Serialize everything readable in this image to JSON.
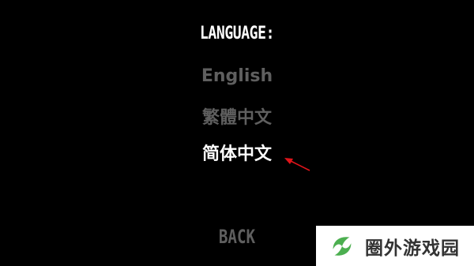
{
  "screen": {
    "title": "LANGUAGE:",
    "languages": [
      {
        "label": "English",
        "selected": false
      },
      {
        "label": "繁體中文",
        "selected": false
      },
      {
        "label": "简体中文",
        "selected": true
      }
    ],
    "back_label": "BACK"
  },
  "annotation": {
    "icon": "red-arrow-icon",
    "color": "#e0141a"
  },
  "watermark": {
    "logo_icon": "leaf-logo-icon",
    "logo_color": "#4caf50",
    "text": "圈外游戏园"
  },
  "colors": {
    "background": "#000000",
    "selected_text": "#ffffff",
    "unselected_text": "#5f5f5f"
  }
}
